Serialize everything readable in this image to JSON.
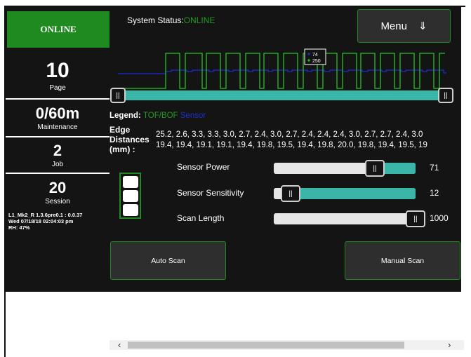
{
  "sidebar": {
    "online_label": "ONLINE",
    "page": {
      "value": "10",
      "label": "Page"
    },
    "maintenance": {
      "value": "0/60m",
      "label": "Maintenance"
    },
    "job": {
      "value": "2",
      "label": "Job"
    },
    "session": {
      "value": "20",
      "label": "Session"
    },
    "info_lines": [
      "L1_Mk2_R 1.3.6pre0.1 : 0.0.37",
      "Wed 07/18/18 02:04:03 pm",
      "RH: 47%"
    ]
  },
  "header": {
    "status_label": "System Status:",
    "status_value": "ONLINE",
    "menu_label": "Menu",
    "menu_icon": "⇓"
  },
  "chart": {
    "tooltip": {
      "blue": "74",
      "green": "250"
    },
    "range_thumb_icon": "||"
  },
  "legend": {
    "label": "Legend:",
    "tof": "TOF/BOF",
    "sensor": "Sensor"
  },
  "edge": {
    "label_line1": "Edge",
    "label_line2": "Distances",
    "label_line3": "(mm) :",
    "row1": "25.2, 2.6, 3.3, 3.3, 3.0, 2.7, 2.4, 3.0, 2.7, 2.4, 2.4, 2.4, 3.0, 2.7, 2.7, 2.4, 3.0",
    "row2": "19.4, 19.4, 19.1, 19.1, 19.4, 19.8, 19.5, 19.4, 19.8, 20.0, 19.8, 19.4, 19.5, 19"
  },
  "sliders": [
    {
      "label": "Sensor Power",
      "value": "71",
      "fraction": 0.71
    },
    {
      "label": "Sensor Sensitivity",
      "value": "12",
      "fraction": 0.12
    },
    {
      "label": "Scan Length",
      "value": "1000",
      "fraction": 1.0
    }
  ],
  "buttons": {
    "auto_scan": "Auto Scan",
    "manual_scan": "Manual Scan"
  },
  "colors": {
    "accent_green": "#1f8a1f",
    "teal": "#3bb5a8",
    "sensor_blue": "#1a2fd0"
  }
}
